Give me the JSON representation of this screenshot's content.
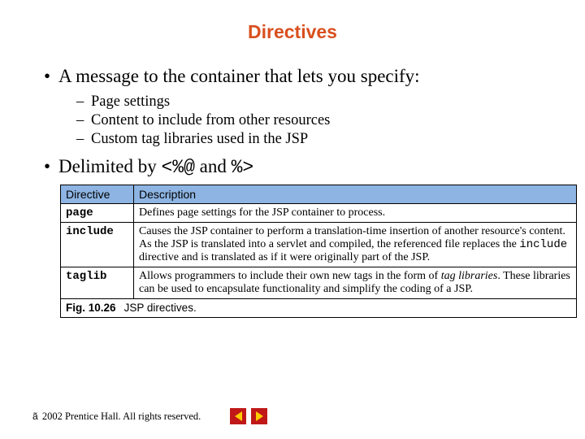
{
  "title": "Directives",
  "bullets": {
    "b1": "A message to the container that lets you specify:",
    "s1": "Page settings",
    "s2": "Content to include from other resources",
    "s3": "Custom tag libraries used in the JSP",
    "b2_pre": "Delimited by ",
    "b2_c1": "<%@",
    "b2_mid": " and ",
    "b2_c2": "%>"
  },
  "table": {
    "h1": "Directive",
    "h2": "Description",
    "rows": [
      {
        "name": "page",
        "desc_plain": "Defines page settings for the JSP container to process."
      },
      {
        "name": "include",
        "desc_pre": "Causes the JSP container to perform a translation-time insertion of another resource's content. As the JSP is translated into a servlet and compiled, the referenced file replaces the ",
        "desc_code": "include",
        "desc_post": " directive and is translated as if it were originally part of the JSP."
      },
      {
        "name": "taglib",
        "desc_pre": "Allows programmers to include their own new tags in the form of ",
        "desc_italic": "tag libraries",
        "desc_post": ". These libraries can be used to encapsulate functionality and simplify the coding of a JSP."
      }
    ],
    "fig_label": "Fig. 10.26",
    "fig_text": "JSP directives."
  },
  "footer": {
    "copy_sym": "ã",
    "text": " 2002 Prentice Hall. All rights reserved."
  }
}
